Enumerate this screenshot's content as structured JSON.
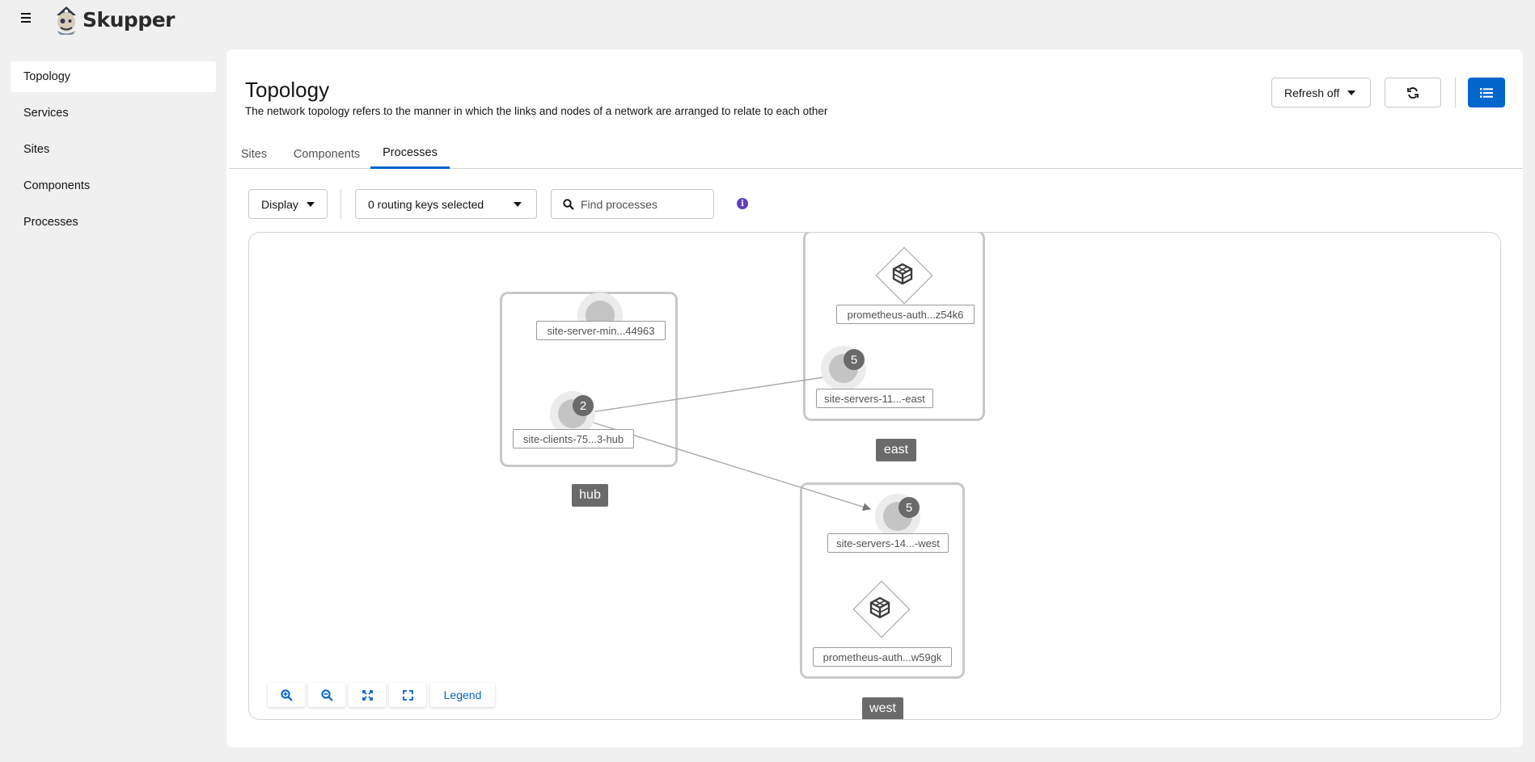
{
  "app": {
    "name": "Skupper"
  },
  "sidebar": {
    "items": [
      {
        "label": "Topology",
        "active": true
      },
      {
        "label": "Services"
      },
      {
        "label": "Sites"
      },
      {
        "label": "Components"
      },
      {
        "label": "Processes"
      }
    ]
  },
  "header": {
    "title": "Topology",
    "description": "The network topology refers to the manner in which the links and nodes of a network are arranged to relate to each other",
    "refresh_label": "Refresh off"
  },
  "tabs": [
    {
      "label": "Sites"
    },
    {
      "label": "Components"
    },
    {
      "label": "Processes",
      "active": true
    }
  ],
  "toolbar": {
    "display_label": "Display",
    "routing_keys_label": "0 routing keys selected",
    "search_placeholder": "Find processes"
  },
  "graph": {
    "sites": [
      {
        "name": "hub"
      },
      {
        "name": "east"
      },
      {
        "name": "west"
      }
    ],
    "nodes": {
      "hub_server": {
        "label": "site-server-min...44963"
      },
      "hub_clients": {
        "label": "site-clients-75...3-hub",
        "count": "2"
      },
      "east_prometheus": {
        "label": "prometheus-auth...z54k6"
      },
      "east_servers": {
        "label": "site-servers-11...-east",
        "count": "5"
      },
      "west_servers": {
        "label": "site-servers-14...-west",
        "count": "5"
      },
      "west_prometheus": {
        "label": "prometheus-auth...w59gk"
      }
    },
    "links": [
      {
        "from": "site-clients-75...3-hub",
        "to": "site-servers-11...-east"
      },
      {
        "from": "site-clients-75...3-hub",
        "to": "site-servers-14...-west"
      }
    ]
  },
  "controls": {
    "zoom_in_icon": "zoom-in-icon",
    "zoom_out_icon": "zoom-out-icon",
    "fit_icon": "fit-to-screen-icon",
    "expand_icon": "expand-icon",
    "legend_label": "Legend"
  },
  "colors": {
    "primary": "#0066cc",
    "info": "#5e40be",
    "site_label_bg": "#6a6a6a",
    "node": "#c4c4c4"
  }
}
